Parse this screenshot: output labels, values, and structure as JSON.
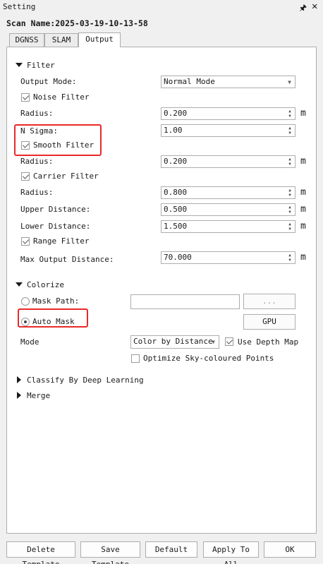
{
  "window": {
    "title": "Setting",
    "pin_icon": "pin-icon",
    "close_icon": "close-icon"
  },
  "scan_name": "Scan Name:2025-03-19-10-13-58",
  "tabs": [
    "DGNSS",
    "SLAM",
    "Output"
  ],
  "active_tab": "Output",
  "filter": {
    "header": "Filter",
    "output_mode_label": "Output Mode:",
    "output_mode_value": "Normal Mode",
    "noise_filter_label": "Noise Filter",
    "radius_label": "Radius:",
    "noise_radius": "0.200",
    "n_sigma_label": "N Sigma:",
    "n_sigma": "1.00",
    "smooth_filter_label": "Smooth Filter",
    "smooth_radius": "0.200",
    "carrier_filter_label": "Carrier Filter",
    "carrier_radius": "0.800",
    "upper_distance_label": "Upper Distance:",
    "upper_distance": "0.500",
    "lower_distance_label": "Lower Distance:",
    "lower_distance": "1.500",
    "range_filter_label": "Range Filter",
    "max_output_distance_label": "Max Output Distance:",
    "max_output_distance": "70.000",
    "unit": "m"
  },
  "colorize": {
    "header": "Colorize",
    "mask_path_label": "Mask Path:",
    "mask_path_value": "",
    "browse_label": "...",
    "auto_mask_label": "Auto Mask",
    "gpu_label": "GPU",
    "mode_label": "Mode",
    "mode_value": "Color by Distance",
    "use_depth_map_label": "Use Depth Map",
    "optimize_sky_label": "Optimize Sky-coloured Points"
  },
  "sections": {
    "classify": "Classify By Deep Learning",
    "merge": "Merge"
  },
  "footer": {
    "delete_template": "Delete Template",
    "save_template": "Save Template",
    "default": "Default",
    "apply_to_all": "Apply To All",
    "ok": "OK"
  },
  "colors": {
    "highlight": "#e82a2a",
    "border": "#adadad",
    "panel_bg": "#ffffff",
    "window_bg": "#f0f0f0"
  }
}
